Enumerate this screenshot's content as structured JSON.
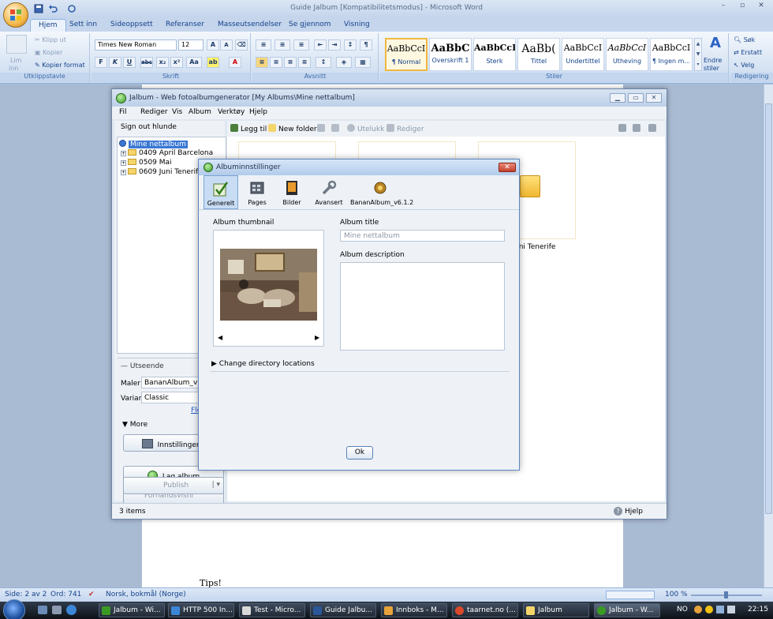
{
  "word": {
    "title": "Guide Jalbum [Kompatibilitetsmodus] - Microsoft Word",
    "tabs": [
      "Hjem",
      "Sett inn",
      "Sideoppsett",
      "Referanser",
      "Masseutsendelser",
      "Se gjennom",
      "Visning"
    ],
    "clipboard": {
      "paste": "Lim",
      "paste2": "inn",
      "cut": "Klipp ut",
      "copy": "Kopier",
      "format_painter": "Kopier format",
      "label": "Utklippstavle"
    },
    "font": {
      "name": "Times New Roman",
      "size": "12",
      "label": "Skrift"
    },
    "paragraph": {
      "label": "Avsnitt"
    },
    "styles": {
      "label": "Stiler",
      "items": [
        {
          "sample": "AaBbCcI",
          "name": "¶ Normal"
        },
        {
          "sample": "AaBbC",
          "name": "Overskrift 1"
        },
        {
          "sample": "AaBbCcI",
          "name": "Sterk"
        },
        {
          "sample": "AaBb(",
          "name": "Tittel"
        },
        {
          "sample": "AaBbCcI",
          "name": "Undertittel"
        },
        {
          "sample": "AaBbCcI",
          "name": "Utheving"
        },
        {
          "sample": "AaBbCcI",
          "name": "¶ Ingen m..."
        }
      ],
      "change_styles": "Endre",
      "change_styles2": "stiler"
    },
    "editing": {
      "find": "Søk",
      "replace": "Erstatt",
      "select": "Velg",
      "label": "Redigering"
    },
    "doc_text": "Tips!",
    "status": {
      "page": "Side: 2 av 2",
      "words": "Ord: 741",
      "language": "Norsk, bokmål (Norge)",
      "zoom": "100 %"
    }
  },
  "jalbum": {
    "title": "Jalbum - Web fotoalbumgenerator [My Albums\\Mine nettalbum]",
    "menu": [
      "Fil",
      "Rediger",
      "Vis",
      "Album",
      "Verktøy",
      "Hjelp"
    ],
    "sign_out": "Sign out hlunde",
    "tree": {
      "root": "Mine nettalbum",
      "children": [
        "0409 April Barcelona",
        "0509 Mai",
        "0609 Juni Tenerife"
      ]
    },
    "toolbar": {
      "add": "Legg til",
      "new_folder": "New folder",
      "exclude": "Utelukk",
      "edit": "Rediger"
    },
    "appearance": {
      "header": "Utseende",
      "skin_label": "Maler",
      "skin_value": "BananAlbum_v6.1.",
      "variant_label": "Variant",
      "variant_value": "Classic",
      "more_link": "Fle",
      "more": "More"
    },
    "buttons": {
      "settings": "Innstillinger...",
      "make_album": "Lag album",
      "preview": "Forhåndsvisni",
      "publish": "Publish"
    },
    "folder_caption": "uni Tenerife",
    "status_items": "3 items",
    "help": "Hjelp"
  },
  "dialog": {
    "title": "Albuminnstillinger",
    "tabs": [
      "Generelt",
      "Pages",
      "Bilder",
      "Avansert",
      "BananAlbum_v6.1.2"
    ],
    "thumbnail_label": "Album thumbnail",
    "album_title_label": "Album title",
    "album_title_value": "Mine nettalbum",
    "description_label": "Album description",
    "change_dirs": "Change directory locations",
    "ok": "Ok"
  },
  "taskbar": {
    "items": [
      "Jalbum - Wi...",
      "HTTP 500 In...",
      "Test - Micro...",
      "Guide Jalbu...",
      "Innboks - M...",
      "taarnet.no (...",
      "Jalbum",
      "Jalbum - W..."
    ],
    "lang": "NO",
    "clock": "22:15"
  }
}
